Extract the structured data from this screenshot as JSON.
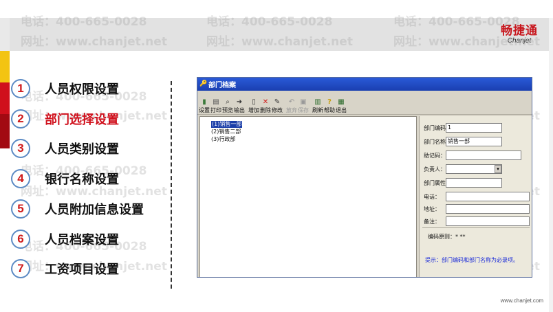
{
  "logo": {
    "cn": "畅捷通",
    "en": "Chanjet"
  },
  "watermarks": [
    {
      "text": "电话：400-665-0028"
    },
    {
      "text": "网址：www.chanjet.net"
    }
  ],
  "menu": [
    {
      "num": "1",
      "label": "人员权限设置",
      "active": false
    },
    {
      "num": "2",
      "label": "部门选择设置",
      "active": true
    },
    {
      "num": "3",
      "label": "人员类别设置",
      "active": false
    },
    {
      "num": "4",
      "label": "银行名称设置",
      "active": false
    },
    {
      "num": "5",
      "label": "人员附加信息设置",
      "active": false
    },
    {
      "num": "6",
      "label": "人员档案设置",
      "active": false
    },
    {
      "num": "7",
      "label": "工资项目设置",
      "active": false
    }
  ],
  "window": {
    "title": "部门档案",
    "toolbar": [
      {
        "label": "设置",
        "icon": "settings-icon",
        "glyph": "▮",
        "color": "#3a7a3a",
        "enabled": true
      },
      {
        "label": "打印",
        "icon": "print-icon",
        "glyph": "▤",
        "color": "#555555",
        "enabled": true
      },
      {
        "label": "预览",
        "icon": "preview-icon",
        "glyph": "🔍",
        "color": "#333333",
        "enabled": true
      },
      {
        "label": "输出",
        "icon": "export-icon",
        "glyph": "➜",
        "color": "#333333",
        "enabled": true
      },
      {
        "label": "增加",
        "icon": "add-icon",
        "glyph": "▯",
        "color": "#333333",
        "enabled": true
      },
      {
        "label": "删除",
        "icon": "delete-icon",
        "glyph": "✕",
        "color": "#d01818",
        "enabled": true
      },
      {
        "label": "修改",
        "icon": "edit-icon",
        "glyph": "✎",
        "color": "#333333",
        "enabled": true
      },
      {
        "label": "放弃",
        "icon": "undo-icon",
        "glyph": "↶",
        "color": "#999999",
        "enabled": false
      },
      {
        "label": "保存",
        "icon": "save-icon",
        "glyph": "▣",
        "color": "#999999",
        "enabled": false
      },
      {
        "label": "刷新",
        "icon": "refresh-icon",
        "glyph": "▥",
        "color": "#2a6a2a",
        "enabled": true
      },
      {
        "label": "帮助",
        "icon": "help-icon",
        "glyph": "?",
        "color": "#c8a010",
        "enabled": true
      },
      {
        "label": "退出",
        "icon": "exit-icon",
        "glyph": "▦",
        "color": "#2a6a2a",
        "enabled": true
      }
    ],
    "tree": [
      {
        "label": "(1)销售一部",
        "selected": true
      },
      {
        "label": "(2)销售二部",
        "selected": false
      },
      {
        "label": "(3)行政部",
        "selected": false
      }
    ],
    "form": {
      "fields": [
        {
          "label": "部门编码",
          "value": "1"
        },
        {
          "label": "部门名称",
          "value": "销售一部"
        },
        {
          "label": "助记码：",
          "value": ""
        },
        {
          "label": "负责人：",
          "value": ""
        },
        {
          "label": "部门属性",
          "value": ""
        },
        {
          "label": "电话：",
          "value": ""
        },
        {
          "label": "地址：",
          "value": ""
        },
        {
          "label": "备注：",
          "value": ""
        }
      ],
      "rule": "编码原则：* **",
      "hint": "提示：部门编码和部门名称为必录项。"
    }
  },
  "footer_url": "www.chanjet.com"
}
